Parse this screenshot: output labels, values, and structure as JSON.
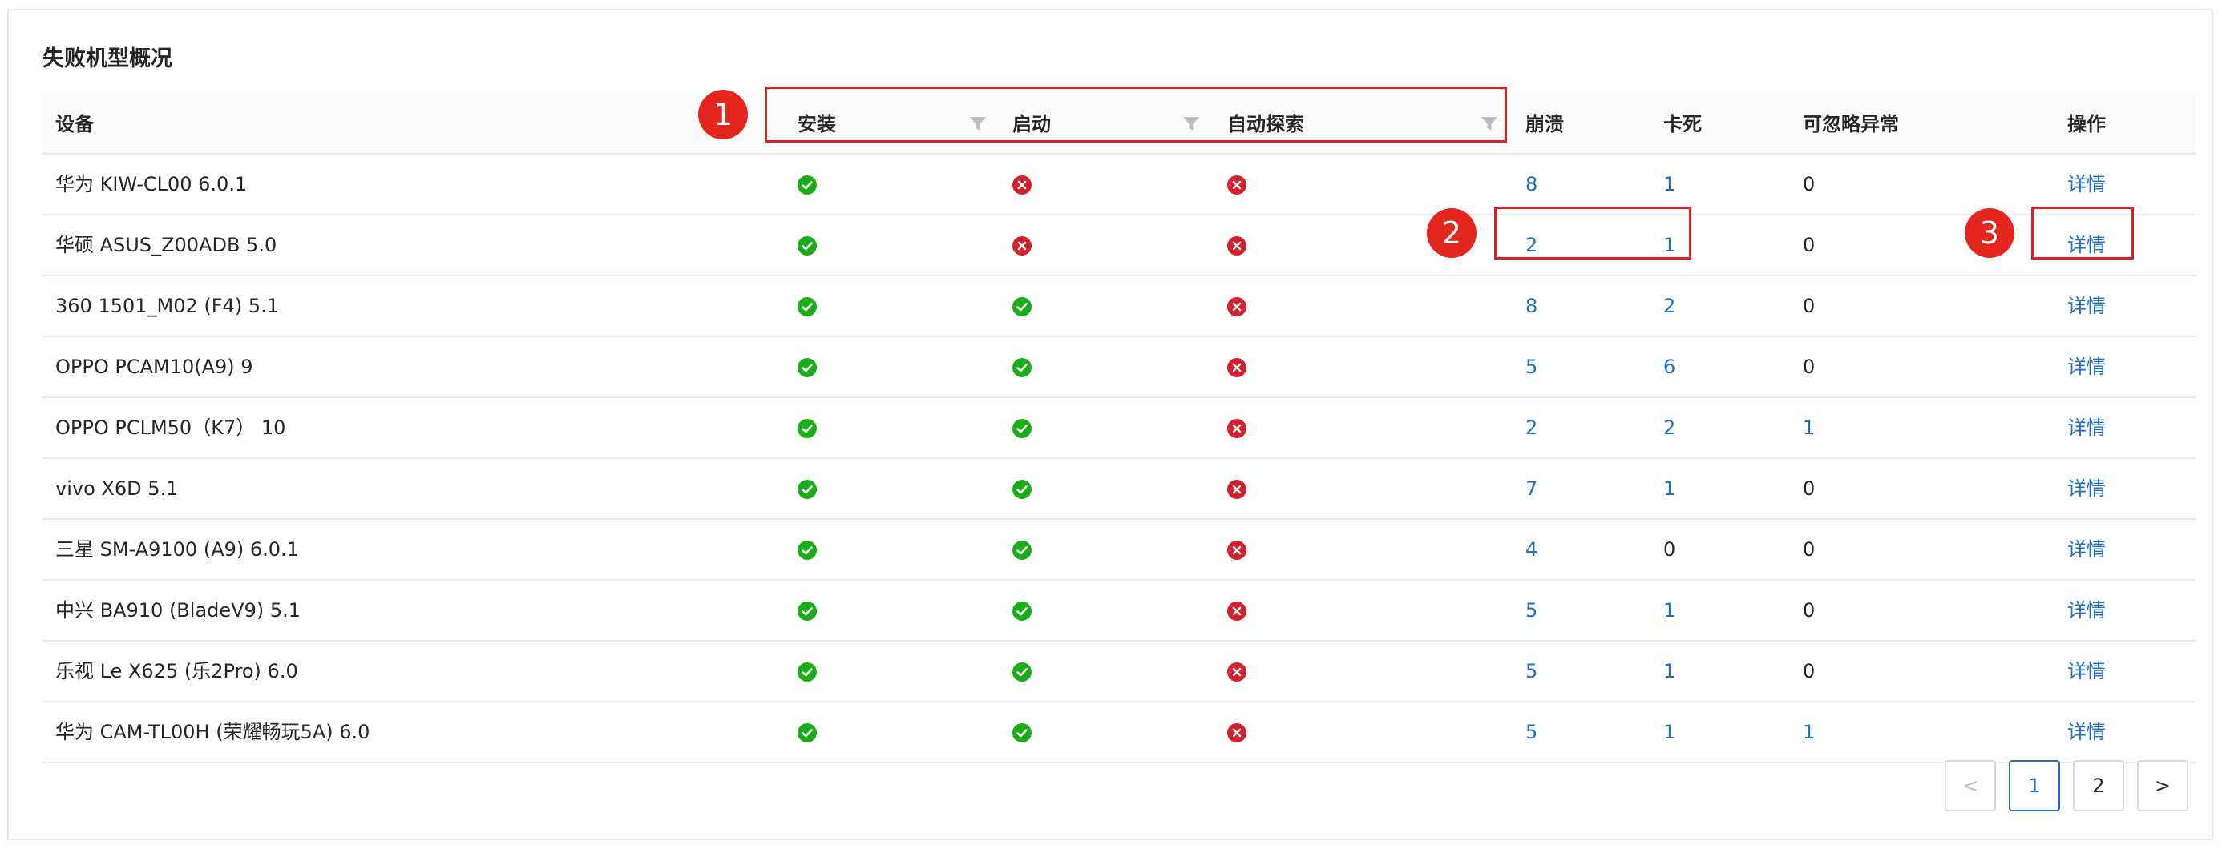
{
  "title": "失败机型概况",
  "columns": {
    "device": "设备",
    "install": "安装",
    "launch": "启动",
    "explore": "自动探索",
    "crash": "崩溃",
    "freeze": "卡死",
    "ignorable": "可忽略异常",
    "action": "操作"
  },
  "rows": [
    {
      "device": "华为 KIW-CL00 6.0.1",
      "install": "pass",
      "launch": "fail",
      "explore": "fail",
      "crash": "8",
      "freeze": "1",
      "ignorable": "0",
      "action": "详情"
    },
    {
      "device": "华硕 ASUS_Z00ADB 5.0",
      "install": "pass",
      "launch": "fail",
      "explore": "fail",
      "crash": "2",
      "freeze": "1",
      "ignorable": "0",
      "action": "详情"
    },
    {
      "device": "360 1501_M02 (F4) 5.1",
      "install": "pass",
      "launch": "pass",
      "explore": "fail",
      "crash": "8",
      "freeze": "2",
      "ignorable": "0",
      "action": "详情"
    },
    {
      "device": "OPPO PCAM10(A9) 9",
      "install": "pass",
      "launch": "pass",
      "explore": "fail",
      "crash": "5",
      "freeze": "6",
      "ignorable": "0",
      "action": "详情"
    },
    {
      "device": "OPPO PCLM50（K7） 10",
      "install": "pass",
      "launch": "pass",
      "explore": "fail",
      "crash": "2",
      "freeze": "2",
      "ignorable": "1",
      "action": "详情"
    },
    {
      "device": "vivo X6D 5.1",
      "install": "pass",
      "launch": "pass",
      "explore": "fail",
      "crash": "7",
      "freeze": "1",
      "ignorable": "0",
      "action": "详情"
    },
    {
      "device": "三星 SM-A9100 (A9) 6.0.1",
      "install": "pass",
      "launch": "pass",
      "explore": "fail",
      "crash": "4",
      "freeze": "0",
      "ignorable": "0",
      "action": "详情"
    },
    {
      "device": "中兴 BA910 (BladeV9) 5.1",
      "install": "pass",
      "launch": "pass",
      "explore": "fail",
      "crash": "5",
      "freeze": "1",
      "ignorable": "0",
      "action": "详情"
    },
    {
      "device": "乐视 Le X625 (乐2Pro) 6.0",
      "install": "pass",
      "launch": "pass",
      "explore": "fail",
      "crash": "5",
      "freeze": "1",
      "ignorable": "0",
      "action": "详情"
    },
    {
      "device": "华为 CAM-TL00H (荣耀畅玩5A) 6.0",
      "install": "pass",
      "launch": "pass",
      "explore": "fail",
      "crash": "5",
      "freeze": "1",
      "ignorable": "1",
      "action": "详情"
    }
  ],
  "annotations": [
    "1",
    "2",
    "3"
  ],
  "pagination": {
    "prev": "<",
    "pages": [
      "1",
      "2"
    ],
    "current": "1",
    "next": ">"
  },
  "colors": {
    "pass": "#1aad19",
    "fail": "#d4202a",
    "link": "#1f6fc5",
    "highlight": "#e02020"
  }
}
